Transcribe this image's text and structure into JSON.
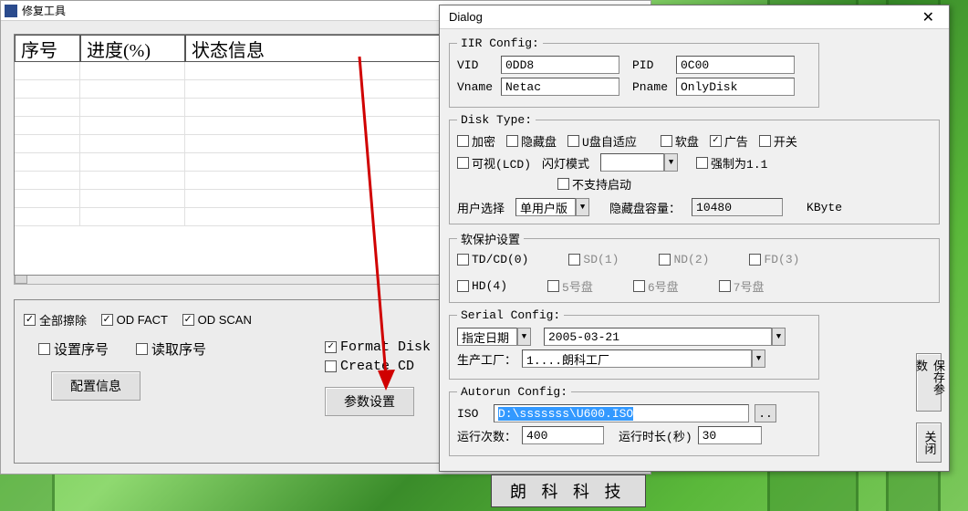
{
  "main_window": {
    "title": "修复工具",
    "table": {
      "col1": "序号",
      "col2": "进度(%)",
      "col3": "状态信息"
    },
    "checkboxes": {
      "erase_all": "全部擦除",
      "od_fact": "OD FACT",
      "od_scan": "OD SCAN",
      "set_serial": "设置序号",
      "read_serial": "读取序号",
      "format_disk": "Format Disk",
      "create_cd": "Create CD"
    },
    "buttons": {
      "config_info": "配置信息",
      "param_set": "参数设置"
    }
  },
  "dialog": {
    "title": "Dialog",
    "iir": {
      "legend": "IIR Config:",
      "vid_lbl": "VID",
      "vid_val": "0DD8",
      "pid_lbl": "PID",
      "pid_val": "0C00",
      "vname_lbl": "Vname",
      "vname_val": "Netac",
      "pname_lbl": "Pname",
      "pname_val": "OnlyDisk"
    },
    "disk_type": {
      "legend": "Disk Type:",
      "encrypt": "加密",
      "hidden_disk": "隐藏盘",
      "u_adapt": "U盘自适应",
      "floppy": "软盘",
      "ad": "广告",
      "switch": "开关",
      "lcd": "可视(LCD)",
      "flash_mode": "闪灯模式",
      "no_boot": "不支持启动",
      "force11": "强制为1.1",
      "user_sel_lbl": "用户选择",
      "user_sel_val": "单用户版",
      "hidden_cap_lbl": "隐藏盘容量：",
      "hidden_cap_val": "10480",
      "hidden_cap_unit": "KByte"
    },
    "soft_protect": {
      "legend": "软保护设置",
      "tdcd": "TD/CD(0)",
      "sd": "SD(1)",
      "nd": "ND(2)",
      "fd": "FD(3)",
      "hd": "HD(4)",
      "d5": "5号盘",
      "d6": "6号盘",
      "d7": "7号盘"
    },
    "serial": {
      "legend": "Serial Config:",
      "date_mode": "指定日期",
      "date_val": "2005-03-21",
      "factory_lbl": "生产工厂：",
      "factory_val": "1....朗科工厂"
    },
    "autorun": {
      "legend": "Autorun Config:",
      "iso_lbl": "ISO",
      "iso_val": "D:\\sssssss\\U600.ISO",
      "runs_lbl": "运行次数：",
      "runs_val": "400",
      "dur_lbl": "运行时长(秒)",
      "dur_val": "30"
    },
    "side_buttons": {
      "save": "保存参数",
      "close": "关闭"
    }
  },
  "bottom_text": "朗 科 科 技"
}
